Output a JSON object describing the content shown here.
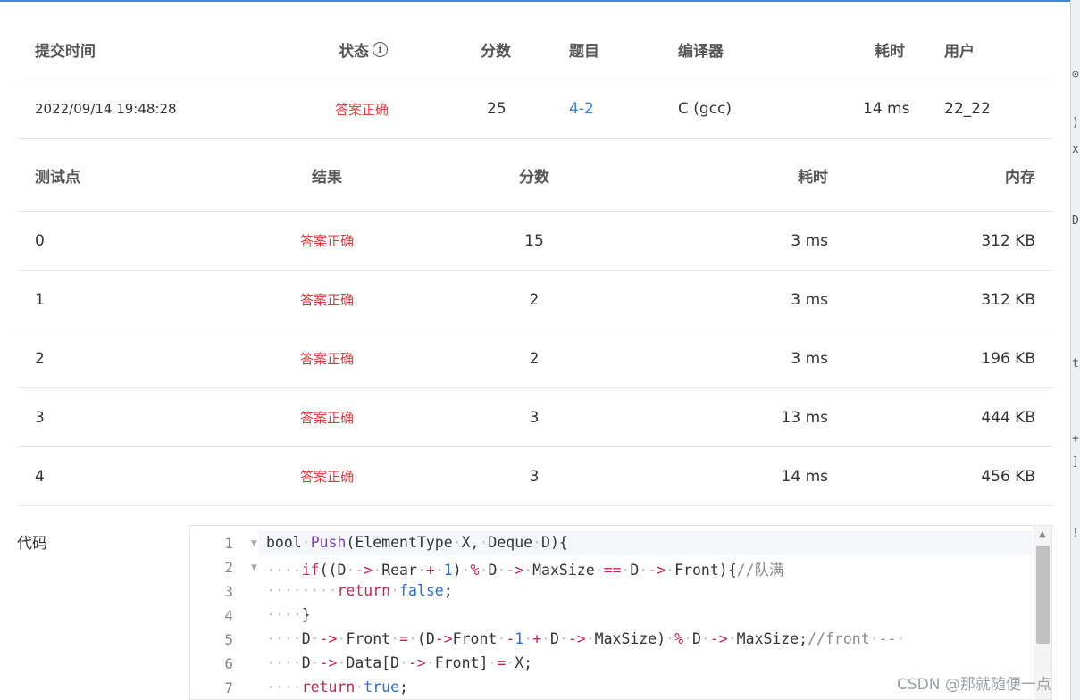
{
  "submission": {
    "headers": {
      "time": "提交时间",
      "status": "状态",
      "score": "分数",
      "problem": "题目",
      "compiler": "编译器",
      "elapsed": "耗时",
      "user": "用户"
    },
    "row": {
      "time": "2022/09/14 19:48:28",
      "status": "答案正确",
      "score": "25",
      "problem": "4-2",
      "compiler": "C (gcc)",
      "elapsed": "14 ms",
      "user": "22_22"
    }
  },
  "testcases": {
    "headers": {
      "case": "测试点",
      "result": "结果",
      "score": "分数",
      "elapsed": "耗时",
      "memory": "内存"
    },
    "rows": [
      {
        "case": "0",
        "result": "答案正确",
        "score": "15",
        "elapsed": "3 ms",
        "memory": "312 KB"
      },
      {
        "case": "1",
        "result": "答案正确",
        "score": "2",
        "elapsed": "3 ms",
        "memory": "312 KB"
      },
      {
        "case": "2",
        "result": "答案正确",
        "score": "2",
        "elapsed": "3 ms",
        "memory": "196 KB"
      },
      {
        "case": "3",
        "result": "答案正确",
        "score": "3",
        "elapsed": "13 ms",
        "memory": "444 KB"
      },
      {
        "case": "4",
        "result": "答案正确",
        "score": "3",
        "elapsed": "14 ms",
        "memory": "456 KB"
      }
    ]
  },
  "code": {
    "label": "代码",
    "line_numbers": [
      "1",
      "2",
      "3",
      "4",
      "5",
      "6",
      "7"
    ]
  },
  "watermark": "CSDN @那就随便一点",
  "colors": {
    "accent": "#4a86d6",
    "correct": "#e0393e",
    "link": "#3b7fd6"
  },
  "icons": {
    "status_info": "info-icon",
    "fold_marker": "caret-down-icon",
    "scroll_up": "caret-up-icon"
  }
}
